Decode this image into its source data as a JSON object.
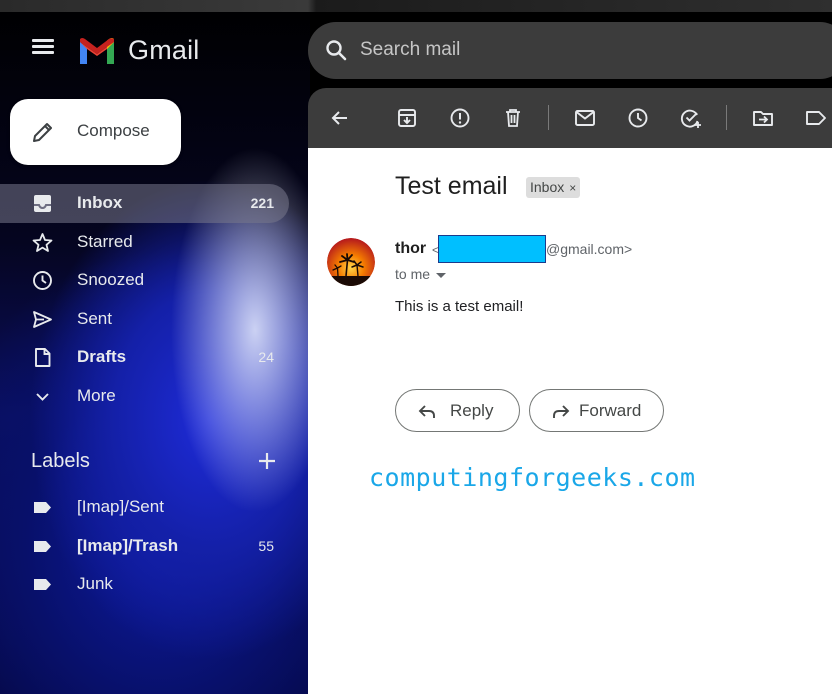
{
  "app": {
    "name": "Gmail"
  },
  "search": {
    "placeholder": "Search mail"
  },
  "compose": {
    "label": "Compose"
  },
  "nav": {
    "items": [
      {
        "label": "Inbox",
        "count": "221",
        "icon": "inbox-icon"
      },
      {
        "label": "Starred",
        "count": "",
        "icon": "star-icon"
      },
      {
        "label": "Snoozed",
        "count": "",
        "icon": "clock-icon"
      },
      {
        "label": "Sent",
        "count": "",
        "icon": "send-icon"
      },
      {
        "label": "Drafts",
        "count": "24",
        "icon": "draft-icon"
      },
      {
        "label": "More",
        "count": "",
        "icon": "chevron-down-icon"
      }
    ]
  },
  "labels": {
    "heading": "Labels",
    "items": [
      {
        "label": "[Imap]/Sent",
        "count": ""
      },
      {
        "label": "[Imap]/Trash",
        "count": "55"
      },
      {
        "label": "Junk",
        "count": ""
      }
    ]
  },
  "toolbar": {
    "icons": [
      "back-arrow-icon",
      "archive-icon",
      "report-spam-icon",
      "delete-icon",
      "mark-unread-icon",
      "snooze-icon",
      "add-to-tasks-icon",
      "move-to-icon",
      "label-icon"
    ]
  },
  "message": {
    "subject": "Test email",
    "chip": "Inbox",
    "chip_close": "×",
    "sender_name": "thor",
    "email_open": "<",
    "email_domain": "@gmail.com>",
    "recipient": "to me",
    "body": "This is a test email!",
    "reply_label": "Reply",
    "forward_label": "Forward"
  },
  "watermark": "computingforgeeks.com",
  "colors": {
    "accent_redaction": "#00bfff",
    "watermark": "#1aa7e8",
    "toolbar_bg": "#3c3c3c",
    "nav_active": "#6e6e82"
  }
}
